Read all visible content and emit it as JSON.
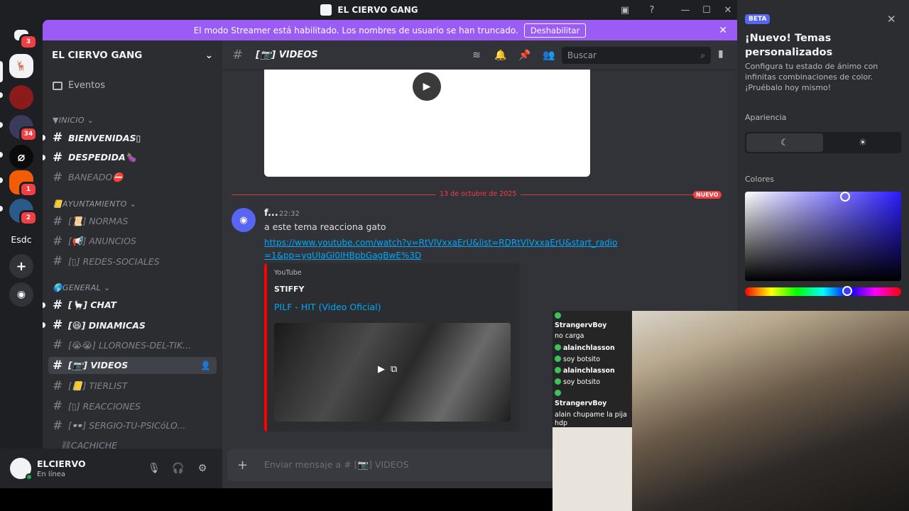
{
  "window": {
    "title": "EL CIERVO GANG"
  },
  "guilds": [
    {
      "label": "",
      "badge": "3",
      "color": "#5865f2"
    },
    {
      "label": "",
      "badge": "",
      "color": "#f2f3f5"
    },
    {
      "label": "",
      "badge": "",
      "color": "#8b1a1a"
    },
    {
      "label": "",
      "badge": "34",
      "color": "#3a3a5a"
    },
    {
      "label": "",
      "badge": "",
      "color": "#1e1f22"
    },
    {
      "label": "",
      "badge": "1",
      "color": "#f25c05"
    },
    {
      "label": "",
      "badge": "2",
      "color": "#2a5a8a"
    },
    {
      "label": "Esdc",
      "badge": "",
      "color": "#313338"
    }
  ],
  "banner": {
    "text": "El modo Streamer está habilitado. Los nombres de usuario se han truncado.",
    "button": "Deshabilitar",
    "close": "✕"
  },
  "server": {
    "name": "EL CIERVO GANG",
    "chevron": "⌄"
  },
  "events_label": "Eventos",
  "categories": [
    {
      "name": "▼INICIO ⌄"
    },
    {
      "name": "📒AYUNTAMIENTO ⌄"
    },
    {
      "name": "🌎GENERAL ⌄"
    }
  ],
  "channels": [
    {
      "name": "BIENVENIDAS▯",
      "state": "unread"
    },
    {
      "name": "DESPEDIDA🍆",
      "state": "unread"
    },
    {
      "name": "BANEADO⛔",
      "state": "read"
    },
    {
      "name": "[📜] NORMAS",
      "state": "read"
    },
    {
      "name": "[📢] ANUNCIOS",
      "state": "read"
    },
    {
      "name": "[▯] REDES-SOCIALES",
      "state": "read"
    },
    {
      "name": "[🦙] CHAT",
      "state": "unread"
    },
    {
      "name": "[😆] DINAMICAS",
      "state": "unread"
    },
    {
      "name": "[😭😭] LLORONES-DEL-TIK...",
      "state": "read"
    },
    {
      "name": "[📷] VIDEOS",
      "state": "active"
    },
    {
      "name": "[📒] TIERLIST",
      "state": "read"
    },
    {
      "name": "[▯] REACCIONES",
      "state": "read"
    },
    {
      "name": "[👓] SERGIO-TU-PSICóLO...",
      "state": "read"
    },
    {
      "name": "⛓CACHICHE",
      "state": "read"
    }
  ],
  "user": {
    "name": "ELCIERVO",
    "status": "En línea"
  },
  "chat": {
    "channel_name": "[📷] VIDEOS",
    "search_placeholder": "Buscar",
    "date_divider": "13 de octubre de 2025",
    "new_tag": "NUEVO",
    "message": {
      "author": "f...",
      "time": "22:32",
      "text": "a este tema reacciona gato",
      "link": "https://www.youtube.com/watch?v=RtVlVxxaErU&list=RDRtVlVxxaErU&start_radio=1&pp=ygUIaGl0IHBpbGagBwE%3D"
    },
    "embed": {
      "provider": "YouTube",
      "author": "STIFFY",
      "title": "PILF - HIT (Video Oficial)",
      "color": "#ff0000"
    },
    "input_placeholder": "Enviar mensaje a # [📷] VIDEOS"
  },
  "theme_panel": {
    "beta": "BETA",
    "title": "¡Nuevo! Temas personalizados",
    "description": "Configura tu estado de ánimo con infinitas combinaciones de color. ¡Pruébalo hoy mismo!",
    "appearance_label": "Apariencia",
    "colors_label": "Colores",
    "dark_icon": "☾",
    "light_icon": "☀"
  },
  "stream_chat": [
    {
      "name": "StrangervBoy",
      "msg": "no carga"
    },
    {
      "name": "alainchlasson",
      "msg": "soy botsito"
    },
    {
      "name": "alainchlasson",
      "msg": "soy botsito"
    },
    {
      "name": "StrangervBoy",
      "msg": "alain chupame la pija hdp"
    }
  ]
}
